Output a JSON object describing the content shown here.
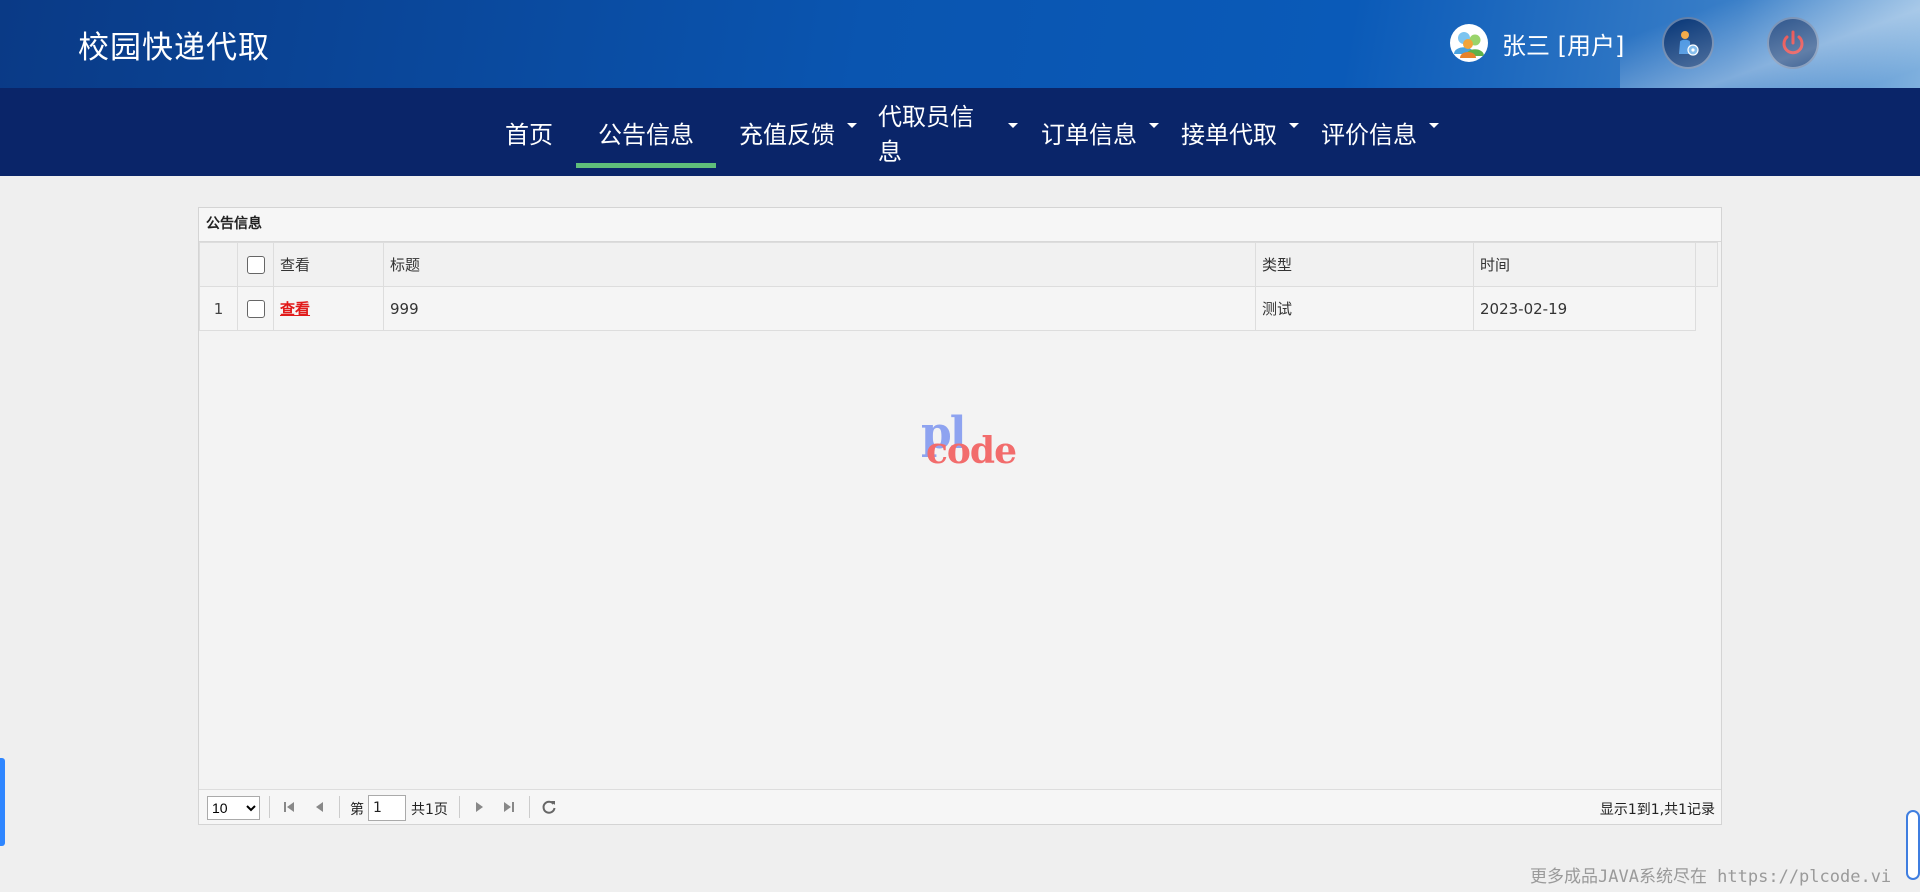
{
  "header": {
    "brand": "校园快递代取",
    "user_name": "张三 [用户]"
  },
  "nav": {
    "items": [
      {
        "label": "首页",
        "has_caret": false,
        "active": false
      },
      {
        "label": "公告信息",
        "has_caret": false,
        "active": true
      },
      {
        "label": "充值反馈",
        "has_caret": true,
        "active": false
      },
      {
        "label": "代取员信息",
        "has_caret": true,
        "active": false
      },
      {
        "label": "订单信息",
        "has_caret": true,
        "active": false
      },
      {
        "label": "接单代取",
        "has_caret": true,
        "active": false
      },
      {
        "label": "评价信息",
        "has_caret": true,
        "active": false
      }
    ]
  },
  "panel": {
    "title": "公告信息",
    "columns": [
      "查看",
      "标题",
      "类型",
      "时间"
    ],
    "rows": [
      {
        "index": "1",
        "view": "查看",
        "title": "999",
        "type": "测试",
        "time": "2023-02-19"
      }
    ]
  },
  "watermark": {
    "top": "pl",
    "bottom": "code"
  },
  "pager": {
    "page_size": "10",
    "page_prefix": "第",
    "page_value": "1",
    "page_suffix": "共1页",
    "info": "显示1到1,共1记录"
  },
  "footer_note": "更多成品JAVA系统尽在 https://plcode.vi",
  "colors": {
    "nav_bg": "#0a2569",
    "active_underline": "#5fbf7a",
    "link_red": "#e11a1a"
  }
}
